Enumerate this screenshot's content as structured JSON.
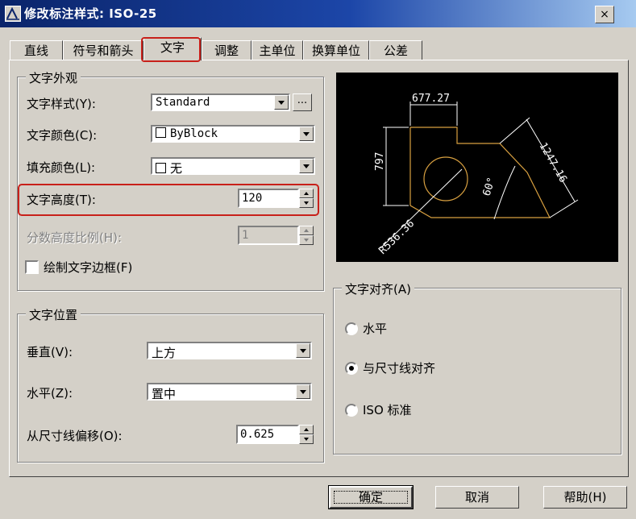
{
  "window": {
    "title": "修改标注样式: ISO-25",
    "close_label": "×"
  },
  "tabs": [
    {
      "label": "直线",
      "active": false
    },
    {
      "label": "符号和箭头",
      "active": false
    },
    {
      "label": "文字",
      "active": true
    },
    {
      "label": "调整",
      "active": false
    },
    {
      "label": "主单位",
      "active": false
    },
    {
      "label": "换算单位",
      "active": false
    },
    {
      "label": "公差",
      "active": false
    }
  ],
  "text_appearance": {
    "title": "文字外观",
    "style_label": "文字样式(Y):",
    "style_value": "Standard",
    "style_button": "...",
    "color_label": "文字颜色(C):",
    "color_value": "ByBlock",
    "fill_label": "填充颜色(L):",
    "fill_value": "无",
    "height_label": "文字高度(T):",
    "height_value": "120",
    "fraction_label": "分数高度比例(H):",
    "fraction_value": "1",
    "frame_label": "绘制文字边框(F)",
    "frame_checked": false
  },
  "text_placement": {
    "title": "文字位置",
    "vertical_label": "垂直(V):",
    "vertical_value": "上方",
    "horizontal_label": "水平(Z):",
    "horizontal_value": "置中",
    "offset_label": "从尺寸线偏移(O):",
    "offset_value": "0.625"
  },
  "text_alignment": {
    "title": "文字对齐(A)",
    "options": [
      {
        "label": "水平",
        "selected": false
      },
      {
        "label": "与尺寸线对齐",
        "selected": true
      },
      {
        "label": "ISO 标准",
        "selected": false
      }
    ]
  },
  "preview": {
    "dim_top": "677.27",
    "dim_left": "797",
    "dim_slant": "1247.16",
    "dim_angle": "60°",
    "dim_radius": "R536.36"
  },
  "buttons": {
    "ok": "确定",
    "cancel": "取消",
    "help": "帮助(H)"
  },
  "colors": {
    "highlight": "#c8201a",
    "preview_bg": "#000000",
    "geometry": "#d8a040",
    "dimension": "#ffffff"
  }
}
